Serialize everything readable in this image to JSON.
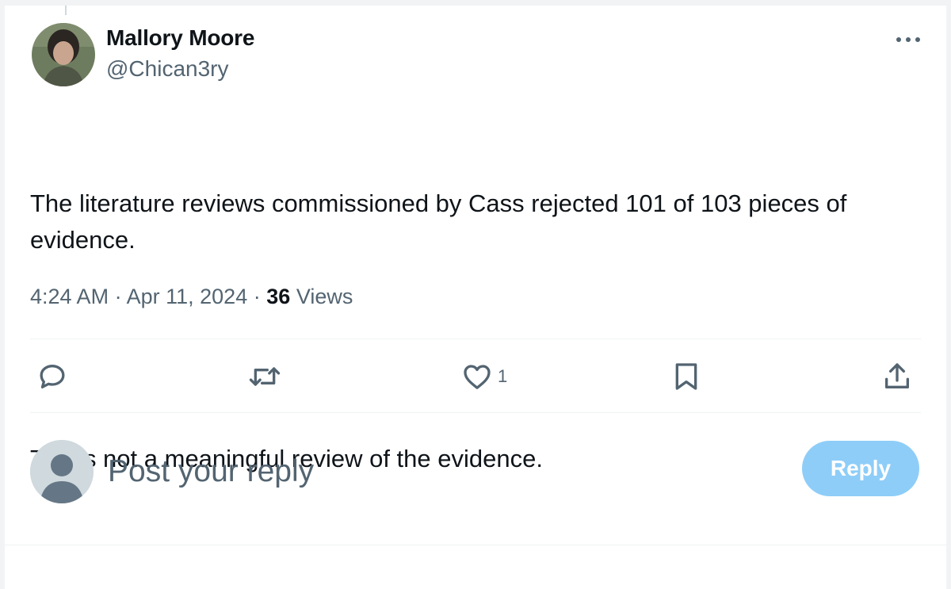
{
  "post": {
    "author_name": "Mallory Moore",
    "author_handle": "@Chican3ry",
    "text_line_1": "The literature reviews commissioned by Cass rejected 101 of 103 pieces of evidence.",
    "text_line_2": "That's not a meaningful review of the evidence.",
    "time": "4:24 AM",
    "separator": "·",
    "date": "Apr 11, 2024",
    "views_count": "36",
    "views_label": "Views"
  },
  "actions": {
    "reply_icon": "speech-bubble-icon",
    "repost_icon": "repost-arrows-icon",
    "like_icon": "heart-icon",
    "like_count": "1",
    "bookmark_icon": "bookmark-icon",
    "share_icon": "share-upload-icon"
  },
  "composer": {
    "placeholder": "Post your reply",
    "reply_button_label": "Reply"
  },
  "colors": {
    "text_primary": "#0f1419",
    "text_secondary": "#536471",
    "reply_button_bg": "#8ecdf8",
    "divider": "#eff3f4"
  }
}
